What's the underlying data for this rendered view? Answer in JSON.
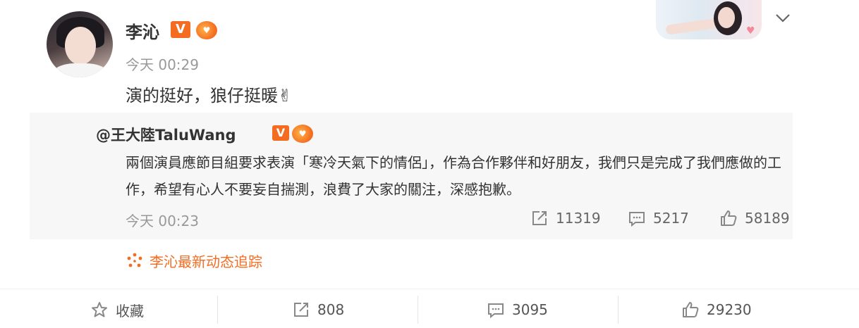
{
  "post": {
    "author": "李沁",
    "time": "今天 00:29",
    "text": "演的挺好，狼仔挺暖✌",
    "badge_v": "V",
    "badge_fan": "♥"
  },
  "repost": {
    "author": "@王大陸TaluWang",
    "text": "兩個演員應節目組要求表演「寒冷天氣下的情侶」，作為合作夥伴和好朋友，我們只是完成了我們應做的工作，希望有心人不要妄自揣測，浪費了大家的關注，深感抱歉。",
    "time": "今天 00:23",
    "reposts": "11319",
    "comments": "5217",
    "likes": "58189"
  },
  "follow_link": "李沁最新动态追踪",
  "action_bar": {
    "favorite": "收藏",
    "reposts": "808",
    "comments": "3095",
    "likes": "29230"
  },
  "colors": {
    "accent": "#f36c21",
    "muted": "#999999",
    "text": "#333333",
    "repost_bg": "#f7f7f7"
  },
  "icons": [
    "chevron-down-icon",
    "repost-icon",
    "comment-icon",
    "like-icon",
    "star-icon",
    "sunburst-icon"
  ]
}
